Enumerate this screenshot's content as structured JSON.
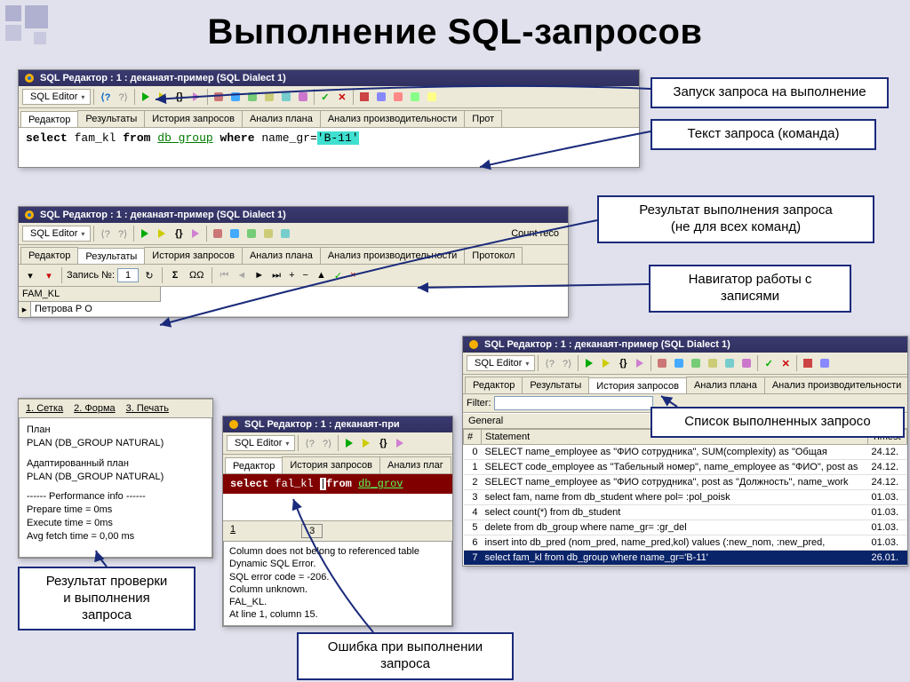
{
  "slide_title": "Выполнение SQL-запросов",
  "window_title": "SQL Редактор : 1 : деканаят-пример (SQL Dialect 1)",
  "toolbar": {
    "dropdown": "SQL Editor"
  },
  "tabs1": {
    "editor": "Редактор",
    "results": "Результаты",
    "history": "История запросов",
    "plan": "Анализ плана",
    "perf": "Анализ производительности",
    "proto": "Прот"
  },
  "tabs_full": {
    "editor": "Редактор",
    "results": "Результаты",
    "history": "История запросов",
    "plan": "Анализ плана",
    "perf": "Анализ производительности",
    "proto": "Протокол"
  },
  "tabs_short": {
    "editor": "Редактор",
    "history": "История запросов",
    "plan": "Анализ плаг"
  },
  "sql": {
    "select": "select",
    "col": "fam_kl",
    "from": "from",
    "table": "db_group",
    "where": "where",
    "cond_col": "name_gr",
    "eq": "=",
    "lit": "'В-11'"
  },
  "sql_err": {
    "select": "select",
    "col": "fal_kl",
    "from": "from",
    "table": "db_grov"
  },
  "callouts": {
    "run": "Запуск запроса на выполнение",
    "text": "Текст запроса (команда)",
    "result": "Результат выполнения  запроса\n(не для всех команд)",
    "nav": "Навигатор работы с\nзаписями",
    "list": "Список выполненных  запросо",
    "check": "Результат проверки\nи выполнения\nзапроса",
    "error": "Ошибка при  выполнении\nзапроса"
  },
  "results": {
    "count_label": "Count reco",
    "record_label": "Запись №:",
    "record_value": "1",
    "col_header": "FAM_KL",
    "row_value": "Петрова Р О"
  },
  "bottom_tabs": {
    "grid": "1. Сетка",
    "form": "2. Форма",
    "print": "3. Печать"
  },
  "plan": {
    "h1": "План",
    "l1": "PLAN (DB_GROUP NATURAL)",
    "h2": "Адаптированный план",
    "l2": "PLAN (DB_GROUP NATURAL)",
    "perf_h": "------ Performance info ------",
    "p1": "Prepare time = 0ms",
    "p2": "Execute time = 0ms",
    "p3": "Avg fetch time = 0,00 ms"
  },
  "err_panel": {
    "pages": {
      "p1": "1",
      "p3": "3"
    },
    "l1": "Column does not belong to referenced table",
    "l2": "Dynamic SQL Error.",
    "l3": "SQL error code = -206.",
    "l4": "Column unknown.",
    "l5": "FAL_KL.",
    "l6": "At line 1, column 15."
  },
  "history": {
    "filter_label": "Filter:",
    "section": "General",
    "cols": {
      "num": "#",
      "stmt": "Statement",
      "time": "Timest"
    },
    "rows": [
      {
        "n": "0",
        "s": "SELECT name_employee as \"ФИО сотрудника\",   SUM(complexity) as \"Общая",
        "t": "24.12."
      },
      {
        "n": "1",
        "s": "SELECT code_employee as \"Табельный номер\", name_employee as \"ФИО\",   post as",
        "t": "24.12."
      },
      {
        "n": "2",
        "s": "SELECT name_employee as \"ФИО сотрудника\", post as \"Должность\",   name_work",
        "t": "24.12."
      },
      {
        "n": "3",
        "s": "select fam, name from db_student where pol= :pol_poisk",
        "t": "01.03."
      },
      {
        "n": "4",
        "s": "select count(*) from db_student",
        "t": "01.03."
      },
      {
        "n": "5",
        "s": "delete from db_group where name_gr= :gr_del",
        "t": "01.03."
      },
      {
        "n": "6",
        "s": "insert into db_pred (nom_pred, name_pred,kol) values (:new_nom, :new_pred,",
        "t": "01.03."
      },
      {
        "n": "7",
        "s": "select fam_kl from db_group where name_gr='B-11'",
        "t": "26.01."
      }
    ]
  }
}
